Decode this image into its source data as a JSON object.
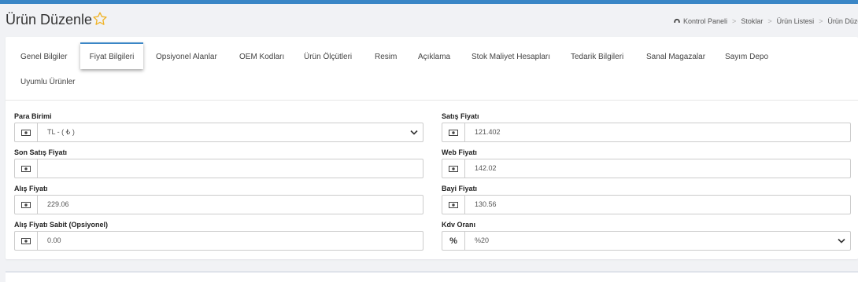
{
  "page": {
    "title": "Ürün Düzenle",
    "accent_color": "#3a86c6",
    "favorite_icon": "star-icon"
  },
  "breadcrumb": {
    "home_icon": "dashboard-icon",
    "items": [
      "Kontrol Paneli",
      "Stoklar",
      "Ürün Listesi",
      "Ürün Düzenle"
    ],
    "separator": ">"
  },
  "tabs": {
    "active": "Fiyat Bilgileri",
    "items": [
      "Genel Bilgiler",
      "Fiyat Bilgileri",
      "Opsiyonel Alanlar",
      "OEM Kodları",
      "Ürün Ölçütleri",
      "Resim",
      "Açıklama",
      "Stok Maliyet Hesapları",
      "Tedarik Bilgileri",
      "Sanal Magazalar",
      "Sayım Depo",
      "Uyumlu Ürünler"
    ]
  },
  "form": {
    "para_birimi": {
      "label": "Para Birimi",
      "value": "TL - ( ₺ )",
      "icon": "money-icon"
    },
    "satis_fiyati": {
      "label": "Satış Fiyatı",
      "value": "121.402",
      "icon": "money-icon"
    },
    "son_satis_fiyati": {
      "label": "Son Satış Fiyatı",
      "value": "",
      "icon": "money-icon"
    },
    "web_fiyati": {
      "label": "Web Fiyatı",
      "value": "142.02",
      "icon": "money-icon"
    },
    "alis_fiyati": {
      "label": "Alış Fiyatı",
      "value": "229.06",
      "icon": "money-icon"
    },
    "bayi_fiyati": {
      "label": "Bayi Fiyatı",
      "value": "130.56",
      "icon": "money-icon"
    },
    "alis_fiyati_sabit": {
      "label": "Alış Fiyatı Sabit (Opsiyonel)",
      "value": "0.00",
      "icon": "money-icon"
    },
    "kdv_orani": {
      "label": "Kdv Oranı",
      "value": "%20",
      "icon_text": "%"
    }
  }
}
